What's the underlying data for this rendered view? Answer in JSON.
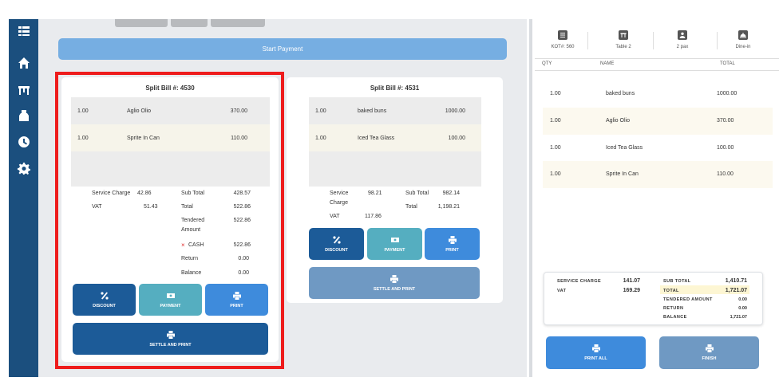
{
  "start_payment_label": "Start Payment",
  "bills": [
    {
      "title": "Split Bill #: 4530",
      "items": [
        {
          "qty": "1.00",
          "name": "Aglio Olio",
          "total": "370.00"
        },
        {
          "qty": "1.00",
          "name": "Sprite In Can",
          "total": "110.00"
        }
      ],
      "summary": {
        "service_charge_label": "Service Charge",
        "service_charge": "42.86",
        "vat_label": "VAT",
        "vat": "51.43",
        "sub_total_label": "Sub Total",
        "sub_total": "428.57",
        "total_label": "Total",
        "total": "522.86",
        "tendered_label": "Tendered Amount",
        "tendered": "522.86",
        "payment_remove_mark": "×",
        "payment_method": "CASH",
        "payment_amount": "522.86",
        "return_label": "Return",
        "return_value": "0.00",
        "balance_label": "Balance",
        "balance": "0.00"
      },
      "buttons": {
        "discount": "DISCOUNT",
        "payment": "PAYMENT",
        "print": "PRINT",
        "settle": "SETTLE AND PRINT"
      }
    },
    {
      "title": "Split Bill #: 4531",
      "items": [
        {
          "qty": "1.00",
          "name": "baked buns",
          "total": "1000.00"
        },
        {
          "qty": "1.00",
          "name": "Iced Tea Glass",
          "total": "100.00"
        }
      ],
      "summary": {
        "service_charge_label": "Service Charge",
        "service_charge": "98.21",
        "vat_label": "VAT",
        "vat": "117.86",
        "sub_total_label": "Sub Total",
        "sub_total": "982.14",
        "total_label": "Total",
        "total": "1,198.21"
      },
      "buttons": {
        "discount": "DISCOUNT",
        "payment": "PAYMENT",
        "print": "PRINT",
        "settle": "SETTLE AND PRINT"
      }
    }
  ],
  "order_header": {
    "kot": "KOT#: 560",
    "table": "Table 2",
    "pax": "2 pax",
    "mode": "Dine-in"
  },
  "columns": {
    "qty": "QTY",
    "name": "NAME",
    "total": "TOTAL"
  },
  "order_items": [
    {
      "qty": "1.00",
      "name": "baked buns",
      "total": "1000.00"
    },
    {
      "qty": "1.00",
      "name": "Aglio Olio",
      "total": "370.00"
    },
    {
      "qty": "1.00",
      "name": "Iced Tea Glass",
      "total": "100.00"
    },
    {
      "qty": "1.00",
      "name": "Sprite In Can",
      "total": "110.00"
    }
  ],
  "totals": {
    "service_charge_label": "SERVICE CHARGE",
    "service_charge": "141.07",
    "vat_label": "VAT",
    "vat": "169.29",
    "sub_total_label": "SUB TOTAL",
    "sub_total": "1,410.71",
    "total_label": "TOTAL",
    "total": "1,721.07",
    "tendered_label": "TENDERED AMOUNT",
    "tendered": "0.00",
    "return_label": "RETURN",
    "return_value": "0.00",
    "balance_label": "BALANCE",
    "balance": "1,721.07"
  },
  "actions": {
    "print_all": "PRINT ALL",
    "finish": "FINISH"
  },
  "colors": {
    "rail": "#1b4f7e",
    "highlight": "#ee1c1c",
    "primary": "#1c5b98",
    "teal": "#55aec0",
    "accent": "#3e8bdc"
  }
}
